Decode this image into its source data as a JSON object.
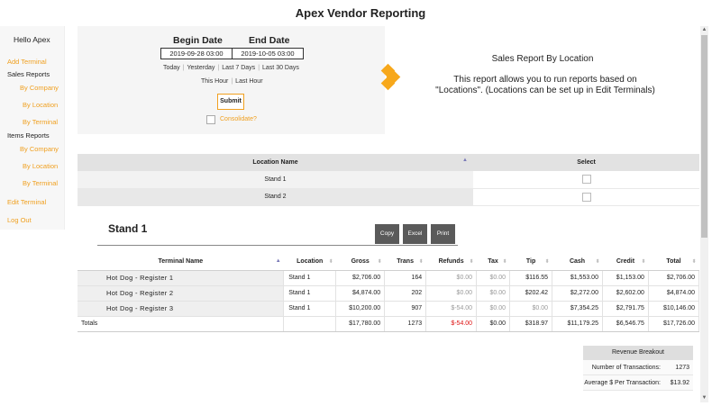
{
  "app": {
    "title": "Apex Vendor Reporting"
  },
  "sidebar": {
    "greeting": "Hello Apex",
    "add_terminal": "Add Terminal",
    "sales_reports": "Sales Reports",
    "sales_by_company": "By Company",
    "sales_by_location": "By Location",
    "sales_by_terminal": "By Terminal",
    "items_reports": "Items Reports",
    "items_by_company": "By Company",
    "items_by_location": "By Location",
    "items_by_terminal": "By Terminal",
    "edit_terminal": "Edit Terminal",
    "log_out": "Log Out"
  },
  "filters": {
    "begin_label": "Begin Date",
    "end_label": "End Date",
    "begin_value": "2019-09-28 03:00",
    "end_value": "2019-10-05 03:00",
    "quick_ranges": [
      "Today",
      "Yesterday",
      "Last 7 Days",
      "Last 30 Days",
      "This Hour",
      "Last Hour"
    ],
    "submit": "Submit",
    "consolidate": "Consolidate?"
  },
  "report": {
    "title": "Sales Report By Location",
    "description": "This report allows you to run reports based on \"Locations\". (Locations can be set up in Edit Terminals)"
  },
  "locations_table": {
    "headers": [
      "Location Name",
      "Select"
    ],
    "rows": [
      "Stand 1",
      "Stand 2"
    ]
  },
  "stand": {
    "title": "Stand 1",
    "buttons": [
      "Copy",
      "Excel",
      "Print"
    ]
  },
  "terminal_table": {
    "headers": [
      "Terminal Name",
      "Location",
      "Gross",
      "Trans",
      "Refunds",
      "Tax",
      "Tip",
      "Cash",
      "Credit",
      "Total"
    ],
    "rows": [
      [
        "Hot Dog - Register 1",
        "Stand 1",
        "$2,706.00",
        "164",
        "$0.00",
        "$0.00",
        "$116.55",
        "$1,553.00",
        "$1,153.00",
        "$2,706.00"
      ],
      [
        "Hot Dog - Register 2",
        "Stand 1",
        "$4,874.00",
        "202",
        "$0.00",
        "$0.00",
        "$202.42",
        "$2,272.00",
        "$2,602.00",
        "$4,874.00"
      ],
      [
        "Hot Dog - Register 3",
        "Stand 1",
        "$10,200.00",
        "907",
        "$-54.00",
        "$0.00",
        "$0.00",
        "$7,354.25",
        "$2,791.75",
        "$10,146.00"
      ]
    ],
    "totals": [
      "Totals",
      "",
      "$17,780.00",
      "1273",
      "$-54.00",
      "$0.00",
      "$318.97",
      "$11,179.25",
      "$6,546.75",
      "$17,726.00"
    ]
  },
  "revenue": {
    "title": "Revenue Breakout",
    "transactions_label": "Number of Transactions:",
    "transactions_value": "1273",
    "avg_label": "Average $ Per Transaction:",
    "avg_value": "$13.92"
  },
  "colors": {
    "accent": "#f0a020",
    "negative": "#dd1111"
  }
}
